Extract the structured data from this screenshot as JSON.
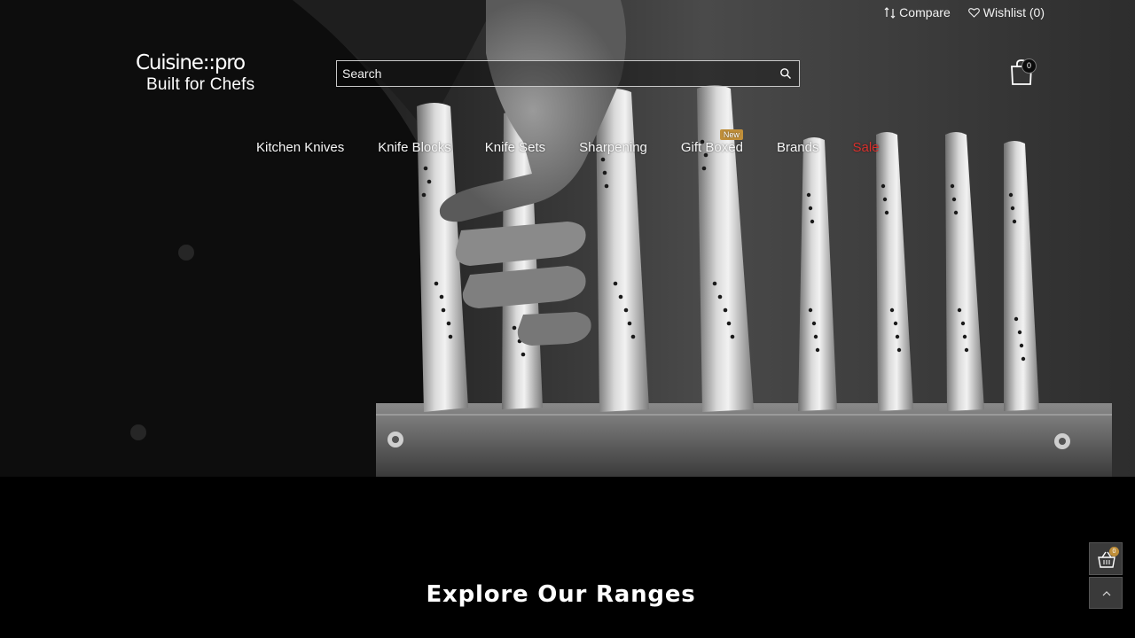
{
  "header": {
    "compare_label": "Compare",
    "wishlist_label": "Wishlist (0)",
    "logo_text": "Cuisine::pro",
    "logo_tagline": "Built for Chefs",
    "search_placeholder": "Search",
    "cart_count": "0",
    "icons": {
      "compare": "compare-arrows-icon",
      "wishlist": "heart-icon",
      "search": "search-icon",
      "cart": "shopping-bag-icon"
    }
  },
  "nav": {
    "items": [
      {
        "label": "Kitchen Knives"
      },
      {
        "label": "Knife Blocks"
      },
      {
        "label": "Knife Sets"
      },
      {
        "label": "Sharpening"
      },
      {
        "label": "Gift Boxed",
        "badge": "New"
      },
      {
        "label": "Brands"
      },
      {
        "label": "Sale"
      }
    ],
    "sale_color": "#d8302c",
    "badge_color": "#c08f3a"
  },
  "main": {
    "section_heading": "Explore Our Ranges"
  },
  "floating": {
    "cart_count": "0",
    "cart_icon": "basket-icon",
    "back_to_top_icon": "chevron-up-icon"
  }
}
